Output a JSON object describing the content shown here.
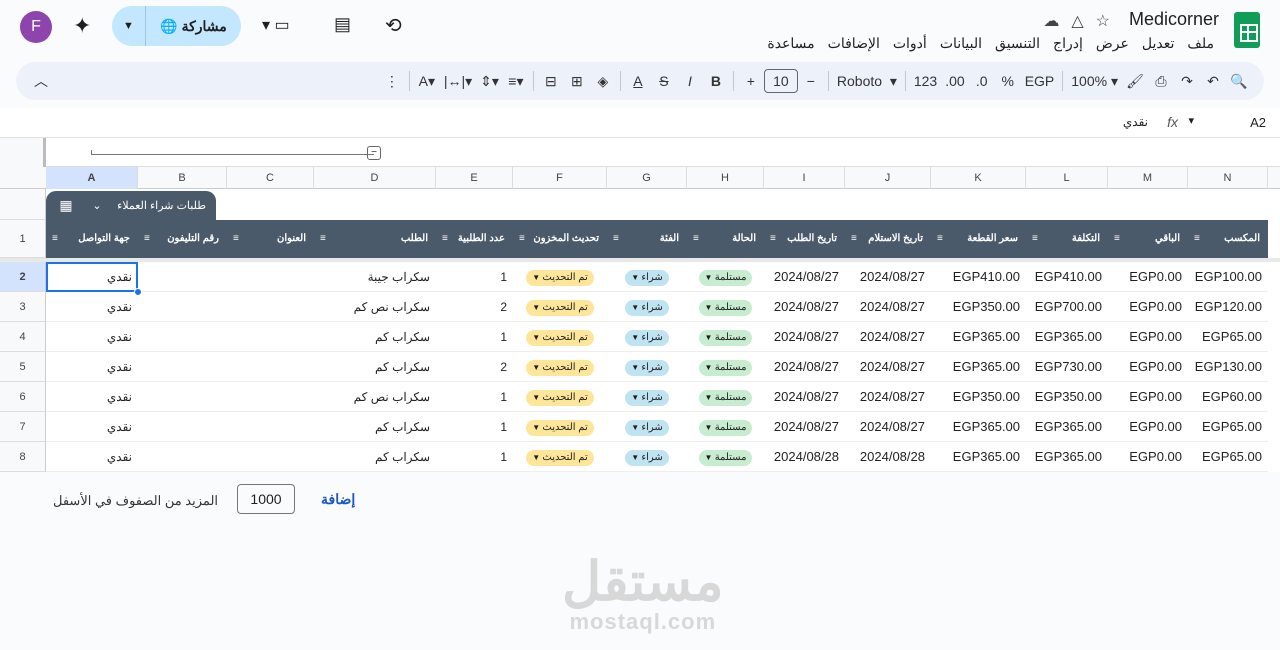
{
  "app": {
    "doc_title": "Medicorner",
    "share_label": "مشاركة",
    "avatar_letter": "F"
  },
  "menu": [
    "ملف",
    "تعديل",
    "عرض",
    "إدراج",
    "التنسيق",
    "البيانات",
    "أدوات",
    "الإضافات",
    "مساعدة"
  ],
  "toolbar": {
    "zoom": "100%",
    "currency": "EGP",
    "percent": "%",
    "dec_dec": ".0",
    "dec_inc": ".00",
    "number_format": "123",
    "font": "Roboto",
    "font_size": "10"
  },
  "formula_bar": {
    "cell_ref": "A2",
    "value": "نقدي"
  },
  "columns": [
    "A",
    "B",
    "C",
    "D",
    "E",
    "F",
    "G",
    "H",
    "I",
    "J",
    "K",
    "L",
    "M",
    "N"
  ],
  "table_name": "طلبات شراء العملاء",
  "headers": [
    "جهة التواصل",
    "رقم التليفون",
    "العنوان",
    "الطلب",
    "عدد الطلبية",
    "تحديث المخزون",
    "الفئة",
    "الحالة",
    "تاريخ الطلب",
    "تاريخ الاستلام",
    "سعر القطعة",
    "التكلفة",
    "الباقي",
    "المكسب"
  ],
  "rows": [
    {
      "n": "2",
      "a": "نقدي",
      "d": "سكراب جيبة",
      "e": "1",
      "f": "تم التحديث",
      "g": "شراء",
      "h": "مستلمة",
      "i": "2024/08/27",
      "j": "2024/08/27",
      "k": "EGP410.00",
      "l": "EGP410.00",
      "m": "EGP0.00",
      "nn": "EGP100.00"
    },
    {
      "n": "3",
      "a": "نقدي",
      "d": "سكراب نص كم",
      "e": "2",
      "f": "تم التحديث",
      "g": "شراء",
      "h": "مستلمة",
      "i": "2024/08/27",
      "j": "2024/08/27",
      "k": "EGP350.00",
      "l": "EGP700.00",
      "m": "EGP0.00",
      "nn": "EGP120.00"
    },
    {
      "n": "4",
      "a": "نقدي",
      "d": "سكراب كم",
      "e": "1",
      "f": "تم التحديث",
      "g": "شراء",
      "h": "مستلمة",
      "i": "2024/08/27",
      "j": "2024/08/27",
      "k": "EGP365.00",
      "l": "EGP365.00",
      "m": "EGP0.00",
      "nn": "EGP65.00"
    },
    {
      "n": "5",
      "a": "نقدي",
      "d": "سكراب كم",
      "e": "2",
      "f": "تم التحديث",
      "g": "شراء",
      "h": "مستلمة",
      "i": "2024/08/27",
      "j": "2024/08/27",
      "k": "EGP365.00",
      "l": "EGP730.00",
      "m": "EGP0.00",
      "nn": "EGP130.00"
    },
    {
      "n": "6",
      "a": "نقدي",
      "d": "سكراب نص كم",
      "e": "1",
      "f": "تم التحديث",
      "g": "شراء",
      "h": "مستلمة",
      "i": "2024/08/27",
      "j": "2024/08/27",
      "k": "EGP350.00",
      "l": "EGP350.00",
      "m": "EGP0.00",
      "nn": "EGP60.00"
    },
    {
      "n": "7",
      "a": "نقدي",
      "d": "سكراب كم",
      "e": "1",
      "f": "تم التحديث",
      "g": "شراء",
      "h": "مستلمة",
      "i": "2024/08/27",
      "j": "2024/08/27",
      "k": "EGP365.00",
      "l": "EGP365.00",
      "m": "EGP0.00",
      "nn": "EGP65.00"
    },
    {
      "n": "8",
      "a": "نقدي",
      "d": "سكراب كم",
      "e": "1",
      "f": "تم التحديث",
      "g": "شراء",
      "h": "مستلمة",
      "i": "2024/08/28",
      "j": "2024/08/28",
      "k": "EGP365.00",
      "l": "EGP365.00",
      "m": "EGP0.00",
      "nn": "EGP65.00"
    }
  ],
  "bottom": {
    "more_rows_label": "المزيد من الصفوف في الأسفل",
    "more_rows_value": "1000",
    "add_label": "إضافة"
  },
  "watermark": {
    "arabic": "مستقل",
    "latin": "mostaql.com"
  },
  "colors": {
    "header_band": "#4a5a6a",
    "chip_update": "#fde59a",
    "chip_buy": "#bfe3f0",
    "chip_received": "#c8ecd0",
    "accent": "#1a73e8"
  }
}
